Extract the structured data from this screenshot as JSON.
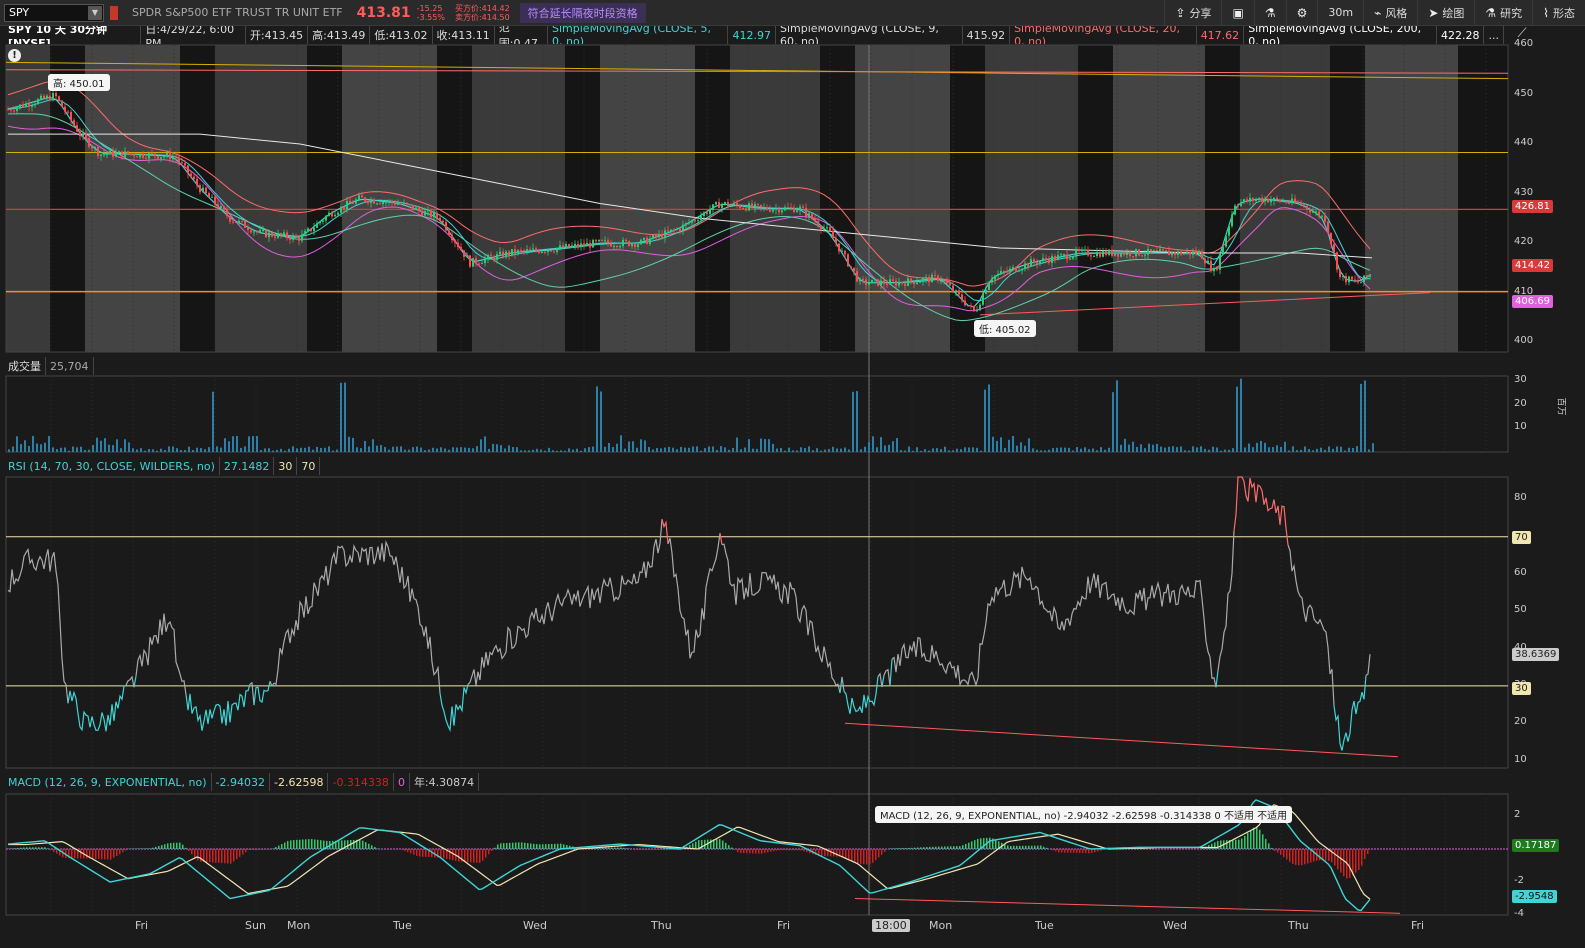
{
  "toolbar": {
    "symbol": "SPY",
    "description": "SPDR S&P500 ETF TRUST TR UNIT ETF",
    "last": "413.81",
    "change": "-15.25",
    "change_pct": "-3.55%",
    "ask": "买方价:414.42",
    "bid": "卖方价:414.50",
    "extended": "符合延长隔夜时段资格",
    "share": "分享",
    "timeframe": "30m",
    "style": "风格",
    "draw": "绘图",
    "studies": "研究",
    "pattern": "形态"
  },
  "price_header": {
    "title": "SPY 10 天 30分钟 [NYSE]",
    "date": "日:4/29/22, 6:00 PM",
    "open": "开:413.45",
    "high": "高:413.49",
    "low": "低:413.02",
    "close": "收:413.11",
    "range": "范围:0.47",
    "sma1": "SimpleMovingAvg (CLOSE, 5, 0, no)",
    "sma1_val": "412.97",
    "sma2": "SimpleMovingAvg (CLOSE, 9, 60, no)",
    "sma2_val": "415.92",
    "sma3": "SimpleMovingAvg (CLOSE, 20, 0, no)",
    "sma3_val": "417.62",
    "sma4": "SimpleMovingAvg (CLOSE, 200, 0, no)",
    "sma4_val": "422.28",
    "more": "..."
  },
  "price_axis": [
    "460",
    "450",
    "440",
    "430",
    "420",
    "410",
    "400"
  ],
  "price_badges": {
    "red": "426.81",
    "current": "414.42",
    "magenta": "406.69"
  },
  "hi_label": "高: 450.01",
  "lo_label": "低: 405.02",
  "volume": {
    "label": "成交量",
    "value": "25,704",
    "axis": [
      "30",
      "20",
      "10"
    ],
    "unit": "百万"
  },
  "rsi": {
    "label": "RSI (14, 70, 30, CLOSE, WILDERS, no)",
    "value": "27.1482",
    "ob": "30",
    "os": "70",
    "axis": [
      "80",
      "70",
      "60",
      "50",
      "40",
      "30",
      "20",
      "10"
    ],
    "badge": "38.6369",
    "b70": "70",
    "b30": "30"
  },
  "macd": {
    "label": "MACD (12, 26, 9, EXPONENTIAL, no)",
    "v1": "-2.94032",
    "v2": "-2.62598",
    "v3": "-0.314338",
    "v4": "0",
    "v5": "年:4.30874",
    "axis": [
      "2",
      "0",
      "-2",
      "-4"
    ],
    "badge1": "0.17187",
    "badge2": "-2.9548",
    "tooltip": "MACD (12, 26, 9, EXPONENTIAL, no) -2.94032 -2.62598 -0.314338 0 不适用 不适用"
  },
  "x_labels": [
    "Fri",
    "Sun",
    "Mon",
    "Tue",
    "Wed",
    "Thu",
    "Fri",
    "18:00",
    "Mon",
    "Tue",
    "Wed",
    "Thu",
    "Fri"
  ],
  "colors": {
    "up": "#2ecc71",
    "down": "#ff4d4d",
    "cyan": "#3fd5d5",
    "magenta": "#e060e0",
    "gold": "#d4b100",
    "orange": "#ff8c1a"
  }
}
